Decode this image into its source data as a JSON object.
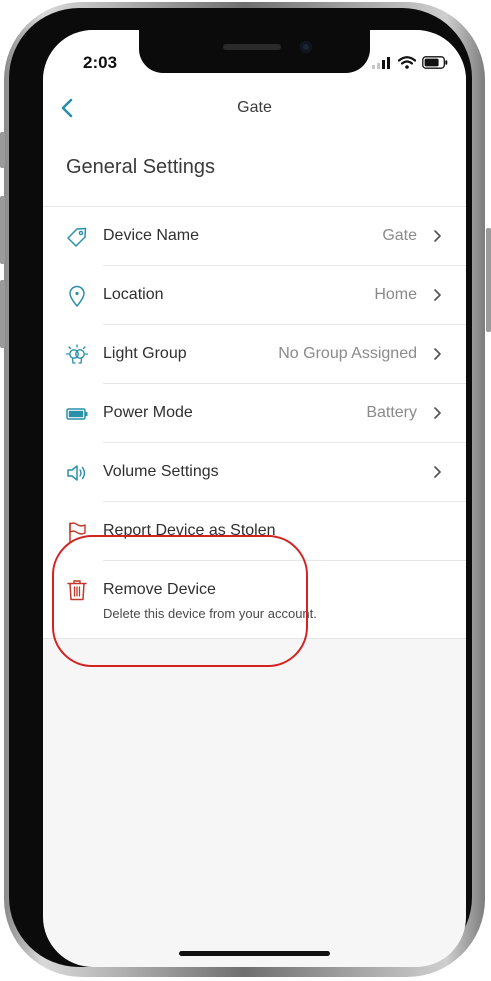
{
  "status_bar": {
    "time": "2:03"
  },
  "nav": {
    "title": "Gate"
  },
  "section": {
    "title": "General Settings"
  },
  "rows": [
    {
      "label": "Device Name",
      "value": "Gate",
      "icon": "tag-icon"
    },
    {
      "label": "Location",
      "value": "Home",
      "icon": "location-pin-icon"
    },
    {
      "label": "Light Group",
      "value": "No Group Assigned",
      "icon": "light-group-icon"
    },
    {
      "label": "Power Mode",
      "value": "Battery",
      "icon": "battery-icon"
    },
    {
      "label": "Volume Settings",
      "value": "",
      "icon": "speaker-icon"
    },
    {
      "label": "Report Device as Stolen",
      "value": "",
      "icon": "flag-icon"
    }
  ],
  "remove": {
    "label": "Remove Device",
    "subtitle": "Delete this device from your account.",
    "icon": "trash-icon"
  },
  "colors": {
    "accent": "#2a8fa8",
    "danger": "#c0392b",
    "annotation": "#d22222"
  }
}
